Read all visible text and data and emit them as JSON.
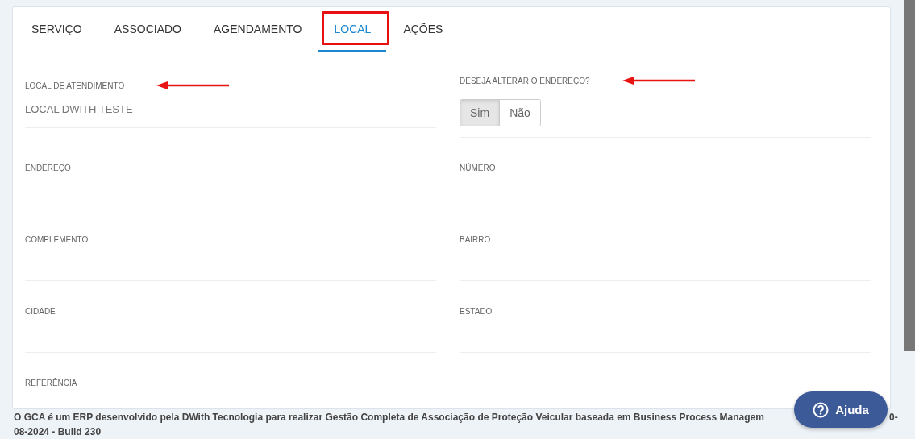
{
  "tabs": [
    {
      "label": "SERVIÇO",
      "selected": false,
      "highlighted": false
    },
    {
      "label": "ASSOCIADO",
      "selected": false,
      "highlighted": false
    },
    {
      "label": "AGENDAMENTO",
      "selected": false,
      "highlighted": false
    },
    {
      "label": "LOCAL",
      "selected": true,
      "highlighted": true
    },
    {
      "label": "AÇÕES",
      "selected": false,
      "highlighted": false
    }
  ],
  "fields": [
    {
      "kind": "text",
      "label": "LOCAL DE ATENDIMENTO",
      "value": "LOCAL DWITH TESTE",
      "arrow": true
    },
    {
      "kind": "toggle",
      "label": "DESEJA ALTERAR O ENDEREÇO?",
      "arrow": true,
      "options": [
        {
          "label": "Sim",
          "selected": true
        },
        {
          "label": "Não",
          "selected": false
        }
      ]
    },
    {
      "kind": "text",
      "label": "ENDEREÇO",
      "arrow": false
    },
    {
      "kind": "text",
      "label": "NÚMERO",
      "arrow": false
    },
    {
      "kind": "text",
      "label": "COMPLEMENTO",
      "arrow": false
    },
    {
      "kind": "text",
      "label": "BAIRRO",
      "arrow": false
    },
    {
      "kind": "text",
      "label": "CIDADE",
      "arrow": false
    },
    {
      "kind": "text",
      "label": "ESTADO",
      "arrow": false
    },
    {
      "kind": "text",
      "label": "REFERÊNCIA",
      "arrow": false
    }
  ],
  "footer": {
    "line_1": "O GCA é um ERP desenvolvido pela DWith Tecnologia para realizar Gestão Completa de Associação de Proteção Veicular baseada em Business Process Managem",
    "line_1_end": "0-",
    "line_2": "08-2024 - Build 230"
  },
  "help_button": {
    "label": "Ajuda"
  }
}
